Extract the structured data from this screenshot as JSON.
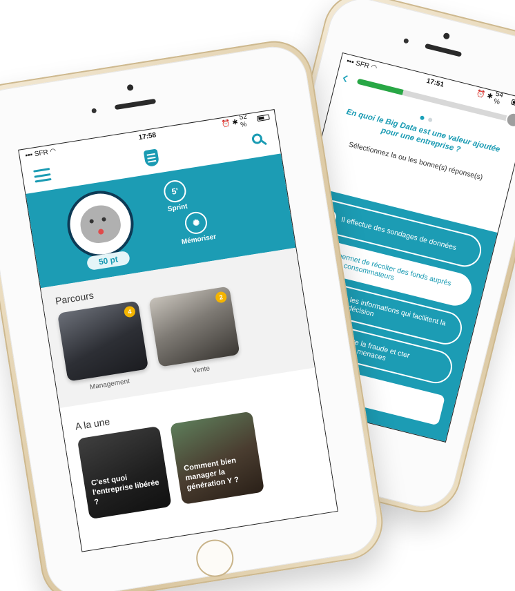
{
  "back_phone": {
    "status_bar": {
      "carrier": "SFR",
      "time": "17:51",
      "battery": "54 %",
      "battery_level": 0.54
    },
    "progress": 0.3,
    "question": "En quoi le Big Data est une valeur ajoutée pour une entreprise ?",
    "instruction": "Sélectionnez la ou les bonne(s) réponse(s)",
    "answers": [
      {
        "text": "Il effectue des sondages de données",
        "selected": false
      },
      {
        "text": "Il permet de récolter des fonds auprès des consommateurs",
        "selected": true
      },
      {
        "text": "Il donne les informations qui facilitent la prise de décision",
        "selected": false
      },
      {
        "text": "ermet de lutter contre la fraude et cter automatiquement les menaces",
        "selected": false
      }
    ],
    "back_icon": "chevron-left-icon",
    "check_icon": "check-icon"
  },
  "front_phone": {
    "status_bar": {
      "carrier": "SFR",
      "time": "17:58",
      "battery": "52 %",
      "battery_level": 0.52
    },
    "header": {
      "menu_icon": "menu-icon",
      "logo_icon": "app-logo-icon",
      "search_icon": "search-icon"
    },
    "profile": {
      "points": "50 pt"
    },
    "modes": [
      {
        "label": "Sprint",
        "icon": "stopwatch-icon"
      },
      {
        "label": "Mémoriser",
        "icon": "brain-icon"
      }
    ],
    "parcours": {
      "title": "Parcours",
      "cards": [
        {
          "caption": "Management",
          "badge": "4"
        },
        {
          "caption": "Vente",
          "badge": "2"
        }
      ]
    },
    "une": {
      "title": "A la une",
      "cards": [
        {
          "text": "C'est quoi l'entreprise libérée ?"
        },
        {
          "text": "Comment bien manager la génération Y ?"
        }
      ]
    },
    "colors": {
      "teal": "#1c9cb4",
      "badge": "#f4b400",
      "navy": "#0d3a55"
    }
  }
}
